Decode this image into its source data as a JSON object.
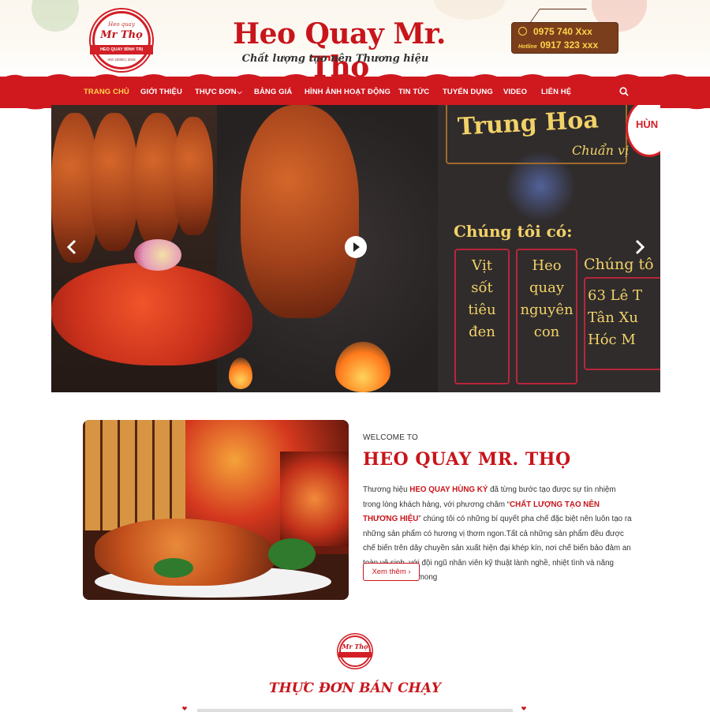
{
  "header": {
    "logo": {
      "top_text": "Heo quay",
      "name": "Mr Thọ",
      "ribbon": "HEO QUAY BÌNH TRỊ",
      "cert": "ISO 22000 | 2018"
    },
    "title": "Heo Quay Mr. Thọ",
    "slogan": "Chất lượng tạo nên Thương hiệu",
    "phone": "0975 740 Xxx",
    "hotline_label": "Hotline",
    "hotline": "0917 323 xxx"
  },
  "nav": {
    "items": [
      {
        "label": "TRANG CHỦ",
        "active": true
      },
      {
        "label": "GIỚI THIỆU"
      },
      {
        "label": "THỰC ĐƠN",
        "has_dropdown": true
      },
      {
        "label": "BẢNG GIÁ"
      },
      {
        "label": "HÌNH ẢNH HOẠT ĐỘNG"
      },
      {
        "label": "TIN TỨC"
      },
      {
        "label": "TUYỂN DỤNG"
      },
      {
        "label": "VIDEO"
      },
      {
        "label": "LIÊN HỆ"
      }
    ],
    "search_icon": "search-icon"
  },
  "slider": {
    "chalk_title": "Trung Hoa",
    "chalk_subtitle": "Chuẩn vị",
    "chalk_heading": "Chúng tôi có:",
    "col1": [
      "Vịt",
      "sốt",
      "tiêu",
      "đen"
    ],
    "col2": [
      "Heo",
      "quay",
      "nguyên",
      "con"
    ],
    "col3_top": "Chúng tô",
    "col3": [
      "63 Lê T",
      "Tân Xu",
      "Hóc M"
    ],
    "badge_text": "HÙN"
  },
  "welcome": {
    "label": "WELCOME TO",
    "title": "HEO QUAY MR. THỌ",
    "p_before": "Thương hiệu ",
    "brand": "HEO QUAY HÙNG KÝ",
    "p_mid": " đã từng bước tạo được sự tín nhiệm trong lòng khách hàng, với phương châm “",
    "motto": "CHẤT LƯỢNG TẠO NÊN THƯƠNG HIỆU",
    "p_after": "” chúng tôi có những bí quyết pha chế đặc biệt nên luôn tạo ra những sản phẩm có hương vị thơm ngon.Tất cả những sản phẩm đều được chế biến trên dây chuyền sản xuất hiện đại khép kín, nơi chế biến bảo đảm an toàn vệ sinh, với đội ngũ nhân viên kỹ thuật lành nghề, nhiệt tình và năng động, chúng tôi mong",
    "more_button": "Xem thêm"
  },
  "bestseller": {
    "logo_text": "Mr Thọ",
    "title": "THỰC ĐƠN BÁN CHẠY"
  },
  "colors": {
    "brand_red": "#c8151b",
    "nav_red": "#d0181f",
    "active_yellow": "#ffd24a",
    "hotline_brown": "#7b3e1c"
  }
}
